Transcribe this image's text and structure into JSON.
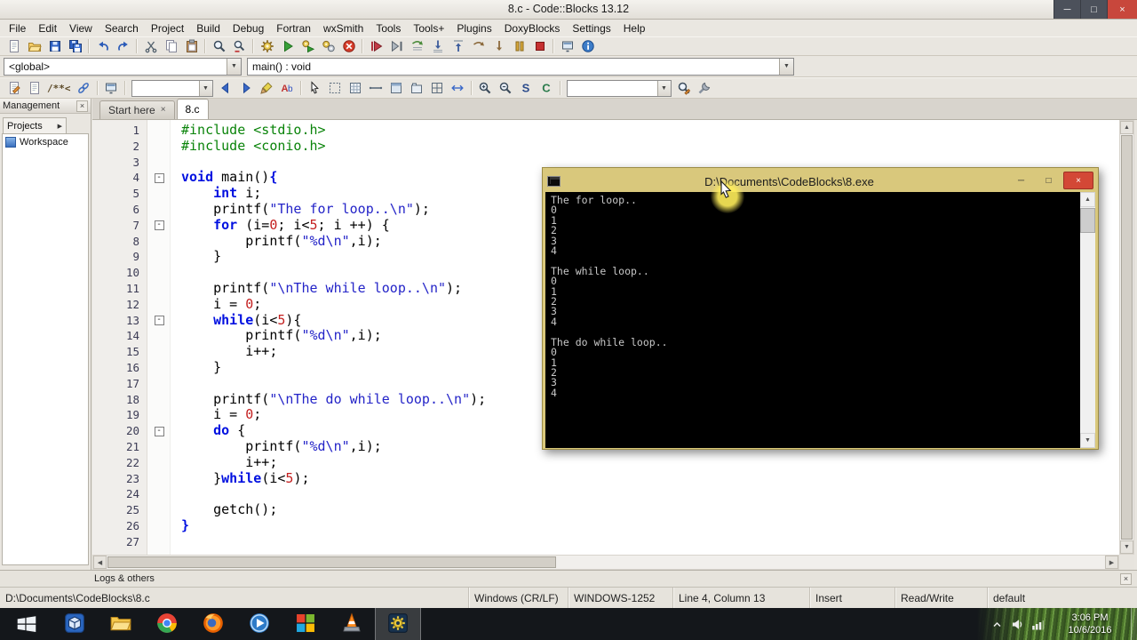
{
  "titlebar": {
    "title": "8.c - Code::Blocks 13.12"
  },
  "menubar": [
    "File",
    "Edit",
    "View",
    "Search",
    "Project",
    "Build",
    "Debug",
    "Fortran",
    "wxSmith",
    "Tools",
    "Tools+",
    "Plugins",
    "DoxyBlocks",
    "Settings",
    "Help"
  ],
  "toolbar_main": [
    {
      "name": "new-file",
      "kind": "page"
    },
    {
      "name": "open-file",
      "kind": "folder"
    },
    {
      "name": "save",
      "kind": "floppy"
    },
    {
      "name": "save-all",
      "kind": "floppies"
    },
    {
      "sep": 1
    },
    {
      "name": "undo",
      "kind": "undo"
    },
    {
      "name": "redo",
      "kind": "redo"
    },
    {
      "sep": 1
    },
    {
      "name": "cut",
      "kind": "scissors"
    },
    {
      "name": "copy",
      "kind": "copy"
    },
    {
      "name": "paste",
      "kind": "paste"
    },
    {
      "sep": 1
    },
    {
      "name": "find",
      "kind": "find"
    },
    {
      "name": "replace",
      "kind": "replace"
    },
    {
      "sep": 1
    },
    {
      "name": "build",
      "kind": "gear"
    },
    {
      "name": "run",
      "kind": "play"
    },
    {
      "name": "build-and-run",
      "kind": "gearplay"
    },
    {
      "name": "rebuild",
      "kind": "gears2"
    },
    {
      "name": "abort-build",
      "kind": "abort"
    },
    {
      "sep": 1
    },
    {
      "name": "debug-continue",
      "kind": "dbgrun"
    },
    {
      "name": "run-to-cursor",
      "kind": "runcursor"
    },
    {
      "name": "next-line",
      "kind": "nextline"
    },
    {
      "name": "step-into",
      "kind": "stepinto"
    },
    {
      "name": "step-out",
      "kind": "stepout"
    },
    {
      "name": "next-instruction",
      "kind": "nextinst"
    },
    {
      "name": "step-into-instruction",
      "kind": "stepinst"
    },
    {
      "name": "break-debugger",
      "kind": "pause"
    },
    {
      "name": "stop-debugger",
      "kind": "stop"
    },
    {
      "sep": 1
    },
    {
      "name": "debugging-windows",
      "kind": "monitor"
    },
    {
      "name": "various-info",
      "kind": "info"
    }
  ],
  "symbol_toolbar": {
    "scope_value": "<global>",
    "function_value": "main() : void"
  },
  "toolbar_secondary": [
    {
      "name": "doxy-extract-docs",
      "kind": "doxypage"
    },
    {
      "name": "doxy-source-file",
      "kind": "page"
    },
    {
      "name": "doxy-comment-block",
      "kind": "text",
      "text": "/**<"
    },
    {
      "name": "doxy-run-html",
      "kind": "link"
    },
    {
      "sep": 1
    },
    {
      "name": "symbols-browser",
      "kind": "monitor"
    },
    {
      "sep": 1
    },
    {
      "name": "incremental-search-field",
      "kind": "combo",
      "w": 92
    },
    {
      "name": "search-previous",
      "kind": "arrowl"
    },
    {
      "name": "search-next",
      "kind": "arrowr"
    },
    {
      "name": "highlight-occurrences",
      "kind": "highlighter"
    },
    {
      "name": "match-case",
      "kind": "lettersab"
    },
    {
      "sep": 1
    },
    {
      "name": "wx-pointer",
      "kind": "pointer"
    },
    {
      "name": "wx-dashed-box",
      "kind": "dashedbox"
    },
    {
      "name": "wx-grid",
      "kind": "grid"
    },
    {
      "name": "wx-static-line",
      "kind": "hline"
    },
    {
      "name": "wx-panel",
      "kind": "panel"
    },
    {
      "name": "wx-notebook",
      "kind": "notebook"
    },
    {
      "name": "wx-sizer",
      "kind": "sizer"
    },
    {
      "name": "wx-spacer",
      "kind": "spacer"
    },
    {
      "sep": 1
    },
    {
      "name": "zoom-in",
      "kind": "zoomin"
    },
    {
      "name": "zoom-out",
      "kind": "zoomout"
    },
    {
      "name": "show-source",
      "kind": "letterS"
    },
    {
      "name": "show-comments",
      "kind": "letterC"
    },
    {
      "sep": 1
    },
    {
      "name": "thread-search-field",
      "kind": "combo",
      "w": 118
    },
    {
      "name": "thread-search",
      "kind": "searchedit"
    },
    {
      "name": "options",
      "kind": "wrench"
    }
  ],
  "management": {
    "title": "Management",
    "tab": "Projects",
    "items": [
      {
        "label": "Workspace"
      }
    ]
  },
  "editor_tabs": [
    {
      "label": "Start here",
      "active": false,
      "closable": true
    },
    {
      "label": "8.c",
      "active": true,
      "closable": false
    }
  ],
  "editor": {
    "lines": [
      {
        "n": 1,
        "t": [
          [
            "pre",
            "#include <stdio.h>"
          ]
        ]
      },
      {
        "n": 2,
        "t": [
          [
            "pre",
            "#include <conio.h>"
          ]
        ]
      },
      {
        "n": 3,
        "t": []
      },
      {
        "n": 4,
        "fold": true,
        "t": [
          [
            "kw",
            "void"
          ],
          [
            "pl",
            " main()"
          ],
          [
            "br",
            "{"
          ]
        ]
      },
      {
        "n": 5,
        "t": [
          [
            "pl",
            "    "
          ],
          [
            "kw",
            "int"
          ],
          [
            "pl",
            " i;"
          ]
        ]
      },
      {
        "n": 6,
        "t": [
          [
            "pl",
            "    printf("
          ],
          [
            "str",
            "\"The for loop..\\n\""
          ],
          [
            "pl",
            ");"
          ]
        ]
      },
      {
        "n": 7,
        "fold": true,
        "t": [
          [
            "pl",
            "    "
          ],
          [
            "kw",
            "for"
          ],
          [
            "pl",
            " (i="
          ],
          [
            "num",
            "0"
          ],
          [
            "pl",
            "; i<"
          ],
          [
            "num",
            "5"
          ],
          [
            "pl",
            "; i ++) {"
          ]
        ]
      },
      {
        "n": 8,
        "t": [
          [
            "pl",
            "        printf("
          ],
          [
            "str",
            "\"%d\\n\""
          ],
          [
            "pl",
            ",i);"
          ]
        ]
      },
      {
        "n": 9,
        "t": [
          [
            "pl",
            "    }"
          ]
        ]
      },
      {
        "n": 10,
        "t": []
      },
      {
        "n": 11,
        "t": [
          [
            "pl",
            "    printf("
          ],
          [
            "str",
            "\"\\nThe while loop..\\n\""
          ],
          [
            "pl",
            ");"
          ]
        ]
      },
      {
        "n": 12,
        "t": [
          [
            "pl",
            "    i = "
          ],
          [
            "num",
            "0"
          ],
          [
            "pl",
            ";"
          ]
        ]
      },
      {
        "n": 13,
        "fold": true,
        "t": [
          [
            "pl",
            "    "
          ],
          [
            "kw",
            "while"
          ],
          [
            "pl",
            "(i<"
          ],
          [
            "num",
            "5"
          ],
          [
            "pl",
            "){"
          ]
        ]
      },
      {
        "n": 14,
        "t": [
          [
            "pl",
            "        printf("
          ],
          [
            "str",
            "\"%d\\n\""
          ],
          [
            "pl",
            ",i);"
          ]
        ]
      },
      {
        "n": 15,
        "t": [
          [
            "pl",
            "        i++;"
          ]
        ]
      },
      {
        "n": 16,
        "t": [
          [
            "pl",
            "    }"
          ]
        ]
      },
      {
        "n": 17,
        "t": []
      },
      {
        "n": 18,
        "t": [
          [
            "pl",
            "    printf("
          ],
          [
            "str",
            "\"\\nThe do while loop..\\n\""
          ],
          [
            "pl",
            ");"
          ]
        ]
      },
      {
        "n": 19,
        "t": [
          [
            "pl",
            "    i = "
          ],
          [
            "num",
            "0"
          ],
          [
            "pl",
            ";"
          ]
        ]
      },
      {
        "n": 20,
        "fold": true,
        "t": [
          [
            "pl",
            "    "
          ],
          [
            "kw",
            "do"
          ],
          [
            "pl",
            " {"
          ]
        ]
      },
      {
        "n": 21,
        "t": [
          [
            "pl",
            "        printf("
          ],
          [
            "str",
            "\"%d\\n\""
          ],
          [
            "pl",
            ",i);"
          ]
        ]
      },
      {
        "n": 22,
        "t": [
          [
            "pl",
            "        i++;"
          ]
        ]
      },
      {
        "n": 23,
        "t": [
          [
            "pl",
            "    }"
          ],
          [
            "kw",
            "while"
          ],
          [
            "pl",
            "(i<"
          ],
          [
            "num",
            "5"
          ],
          [
            "pl",
            ");"
          ]
        ]
      },
      {
        "n": 24,
        "t": []
      },
      {
        "n": 25,
        "t": [
          [
            "pl",
            "    getch();"
          ]
        ]
      },
      {
        "n": 26,
        "t": [
          [
            "br",
            "}"
          ]
        ]
      },
      {
        "n": 27,
        "t": []
      }
    ]
  },
  "console_window": {
    "title": "D:\\Documents\\CodeBlocks\\8.exe",
    "lines": [
      "The for loop..",
      "0",
      "1",
      "2",
      "3",
      "4",
      "",
      "The while loop..",
      "0",
      "1",
      "2",
      "3",
      "4",
      "",
      "The do while loop..",
      "0",
      "1",
      "2",
      "3",
      "4"
    ]
  },
  "logs_panel": {
    "title": "Logs & others"
  },
  "statusbar": {
    "segments": [
      "D:\\Documents\\CodeBlocks\\8.c",
      "Windows (CR/LF)",
      "WINDOWS-1252",
      "Line 4, Column 13",
      "Insert",
      "Read/Write",
      "default"
    ]
  },
  "taskbar": {
    "apps": [
      {
        "name": "virtualbox",
        "kind": "vbox"
      },
      {
        "name": "file-explorer",
        "kind": "explorer"
      },
      {
        "name": "chrome",
        "kind": "chrome"
      },
      {
        "name": "firefox",
        "kind": "firefox"
      },
      {
        "name": "media-player",
        "kind": "wmp"
      },
      {
        "name": "windows-apps",
        "kind": "colorgrid"
      },
      {
        "name": "vlc",
        "kind": "vlc"
      },
      {
        "name": "codeblocks",
        "kind": "codeblocks",
        "active": true
      }
    ],
    "tray": [
      {
        "name": "show-hidden-icons",
        "kind": "chevron"
      },
      {
        "name": "volume",
        "kind": "volume"
      },
      {
        "name": "network",
        "kind": "network"
      }
    ],
    "clock": {
      "time": "3:06 PM",
      "date": "10/6/2016"
    }
  },
  "colors": {
    "console_frame": "#d9c87c",
    "close_button": "#d34836",
    "keyword": "#0010e0",
    "preprocessor": "#0a840a",
    "string": "#2424c8",
    "number": "#c42020"
  }
}
